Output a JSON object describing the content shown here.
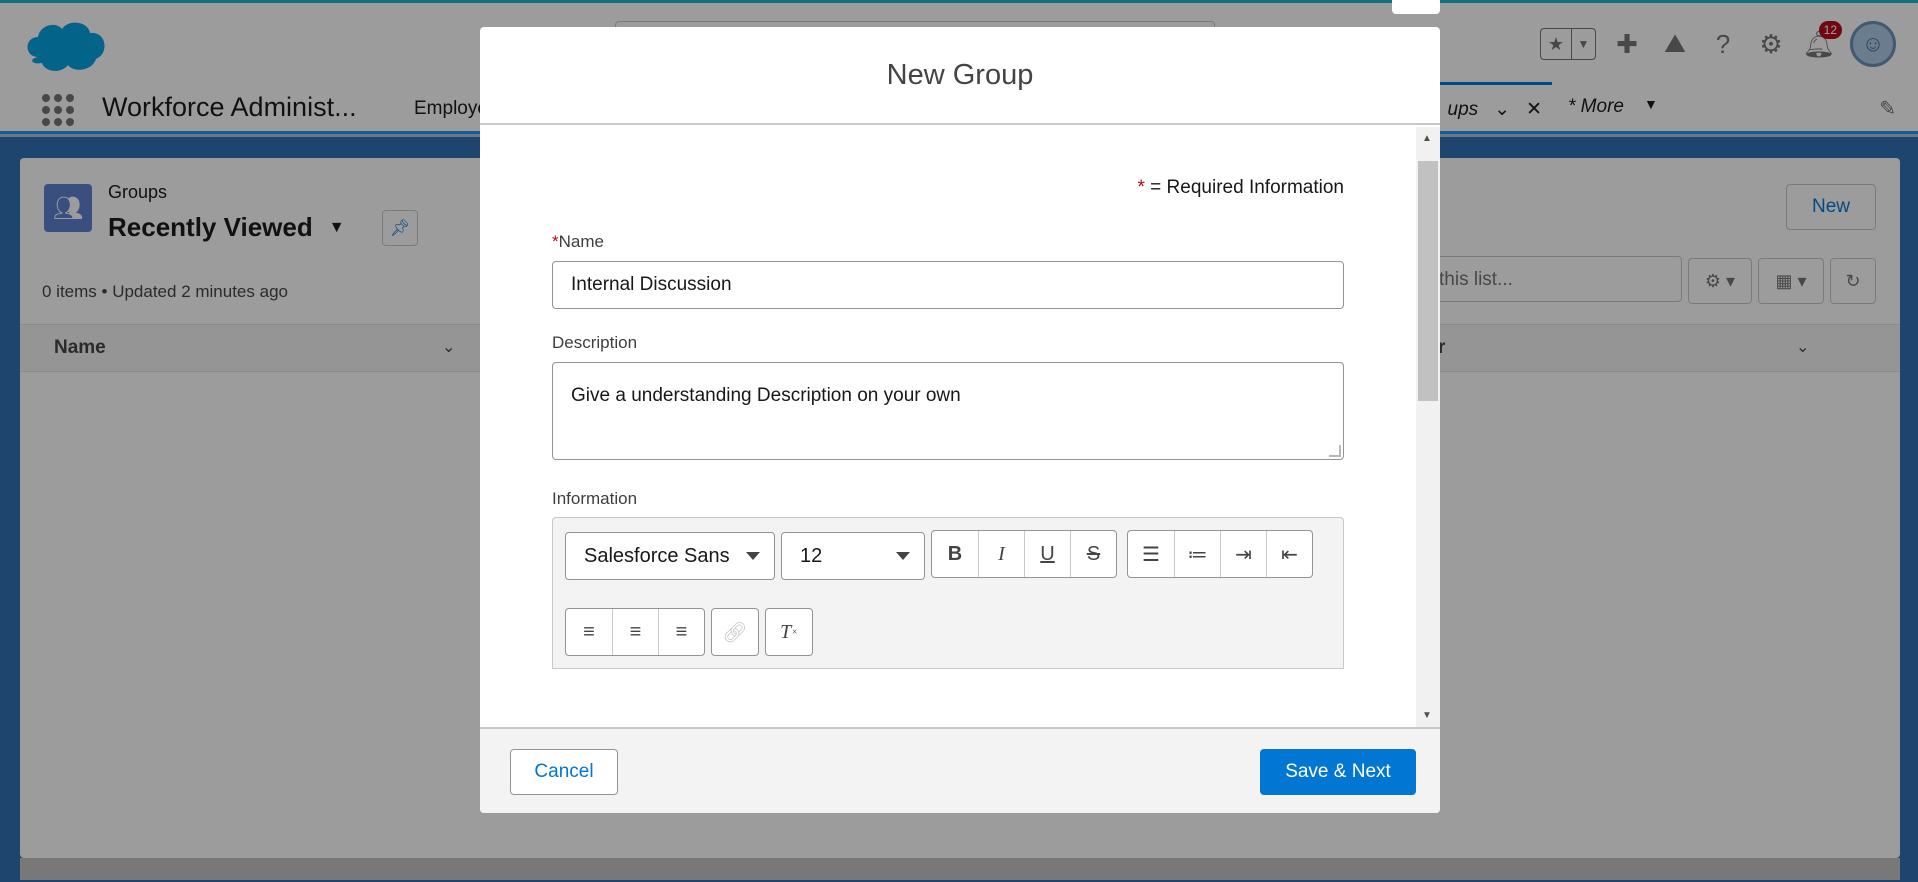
{
  "header": {
    "notification_count": "12"
  },
  "navbar": {
    "app_name": "Workforce Administ...",
    "employees_partial": "Employe",
    "groups_tab_partial": "ups",
    "more_label": "* More"
  },
  "list_view": {
    "object_label": "Groups",
    "list_name": "Recently Viewed",
    "meta": "0 items • Updated 2 minutes ago",
    "new_label": "New",
    "search_placeholder_partial": "this list...",
    "column_name": "Name",
    "column_partial": "r"
  },
  "modal": {
    "title": "New Group",
    "required_note": " = Required Information",
    "required_star": "*",
    "name_label": "Name",
    "name_value": "Internal Discussion",
    "description_label": "Description",
    "description_value": "Give a understanding Description on your own",
    "information_label": "Information",
    "font_family": "Salesforce Sans",
    "font_size": "12",
    "cancel_label": "Cancel",
    "save_next_label": "Save & Next"
  },
  "colors": {
    "brand": "#0176d3",
    "required": "#ba0517",
    "top_accent": "#1ab9c9"
  }
}
